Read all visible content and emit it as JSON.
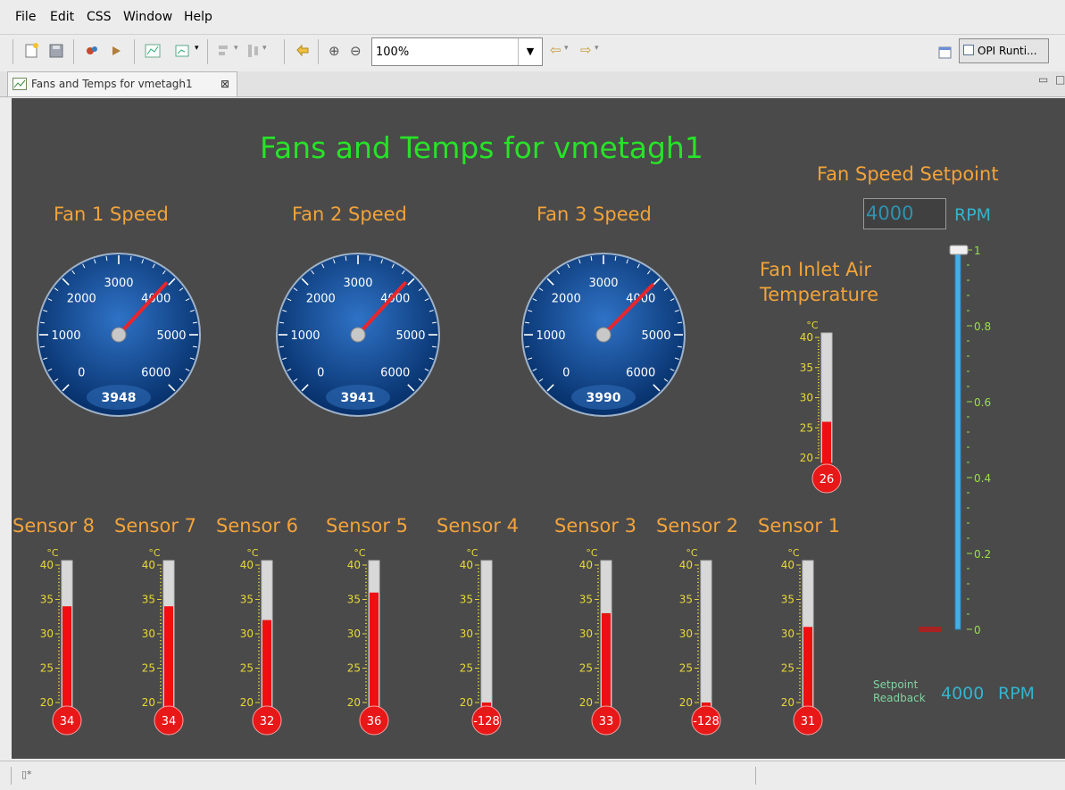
{
  "menu": [
    {
      "label": "File"
    },
    {
      "label": "Edit"
    },
    {
      "label": "CSS"
    },
    {
      "label": "Window"
    },
    {
      "label": "Help"
    }
  ],
  "toolbar": {
    "zoom_value": "100%",
    "perspective": "OPI Runti..."
  },
  "tab": {
    "title": "Fans and Temps for vmetagh1"
  },
  "page": {
    "title": "Fans and Temps for vmetagh1"
  },
  "fans": [
    {
      "label": "Fan 1 Speed",
      "value": 3948,
      "readout": "3948"
    },
    {
      "label": "Fan 2 Speed",
      "value": 3941,
      "readout": "3941"
    },
    {
      "label": "Fan 3 Speed",
      "value": 3990,
      "readout": "3990"
    }
  ],
  "gauge_ticks": [
    "0",
    "1000",
    "2000",
    "3000",
    "4000",
    "5000",
    "6000"
  ],
  "gauge_range": [
    0,
    6000
  ],
  "inlet": {
    "title_line1": "Fan Inlet Air",
    "title_line2": "Temperature",
    "unit": "°C",
    "value": 26,
    "readout": "26"
  },
  "thermo_ticks": [
    "40",
    "35",
    "30",
    "25",
    "20"
  ],
  "thermo_range": [
    20,
    40
  ],
  "sensors": [
    {
      "label": "Sensor 8",
      "value": 34,
      "readout": "34"
    },
    {
      "label": "Sensor 7",
      "value": 34,
      "readout": "34"
    },
    {
      "label": "Sensor 6",
      "value": 32,
      "readout": "32"
    },
    {
      "label": "Sensor 5",
      "value": 36,
      "readout": "36"
    },
    {
      "label": "Sensor 4",
      "value": -128,
      "readout": "-128"
    },
    {
      "label": "Sensor 3",
      "value": 33,
      "readout": "33"
    },
    {
      "label": "Sensor 2",
      "value": -128,
      "readout": "-128"
    },
    {
      "label": "Sensor 1",
      "value": 31,
      "readout": "31"
    }
  ],
  "setpoint": {
    "title": "Fan Speed Setpoint",
    "value": "4000",
    "unit": "RPM",
    "slider_ticks": [
      "1",
      "0.8",
      "0.6",
      "0.4",
      "0.2",
      "0"
    ],
    "slider_level": 1
  },
  "readback": {
    "label_line1": "Setpoint",
    "label_line2": "Readback",
    "value": "4000",
    "unit": "RPM"
  },
  "colors": {
    "title": "#28e228",
    "label": "#f2a33a",
    "readout": "#35b3cf",
    "gauge": "#0b3c7a",
    "needle": "#e8262c",
    "thermo_fill": "#ee1010",
    "tick": "#e8d838"
  }
}
